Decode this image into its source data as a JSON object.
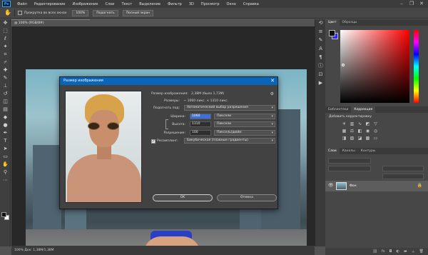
{
  "app": {
    "logo": "Ps"
  },
  "menu": [
    "Файл",
    "Редактирование",
    "Изображение",
    "Слои",
    "Текст",
    "Выделение",
    "Фильтр",
    "3D",
    "Просмотр",
    "Окно",
    "Справка"
  ],
  "options_bar": {
    "checkbox_label": "Прокрутка во всех окнах",
    "zoom_button": "100%",
    "fit_button": "Подогнать",
    "fill_button": "Полный экран"
  },
  "document": {
    "tab_title": "@ 100% (RGB/8#)",
    "status": "100%   Док: 1,38M/1,38M"
  },
  "dialog": {
    "title": "Размер изображения",
    "size_label": "Размер изображения:",
    "size_value": "2,38M (было 1,73M)",
    "dimensions_label": "Размеры:",
    "dimensions_value": "~ 1060 пикс. × 1310 пикс.",
    "fit_label": "Подогнать под:",
    "fit_value": "Автоматический выбор разрешения",
    "width_label": "Ширина:",
    "width_value": "1060",
    "width_unit": "Пиксели",
    "height_label": "Высота:",
    "height_value": "1310",
    "height_unit": "Пиксели",
    "resolution_label": "Разрешение:",
    "resolution_value": "100",
    "resolution_unit": "Пиксель/дюйм",
    "resample_label": "Ресамплинг:",
    "resample_value": "Бикубическая (плавные градиенты)",
    "ok_label": "OK",
    "cancel_label": "Отмена"
  },
  "panels": {
    "color_tabs": [
      "Цвет",
      "Образцы"
    ],
    "adjust_tabs": [
      "Библиотеки",
      "Коррекция"
    ],
    "adjust_title": "Добавить корректировку",
    "layers_tabs": [
      "Слои",
      "Каналы",
      "Контуры"
    ],
    "layer_name": "Фон"
  }
}
